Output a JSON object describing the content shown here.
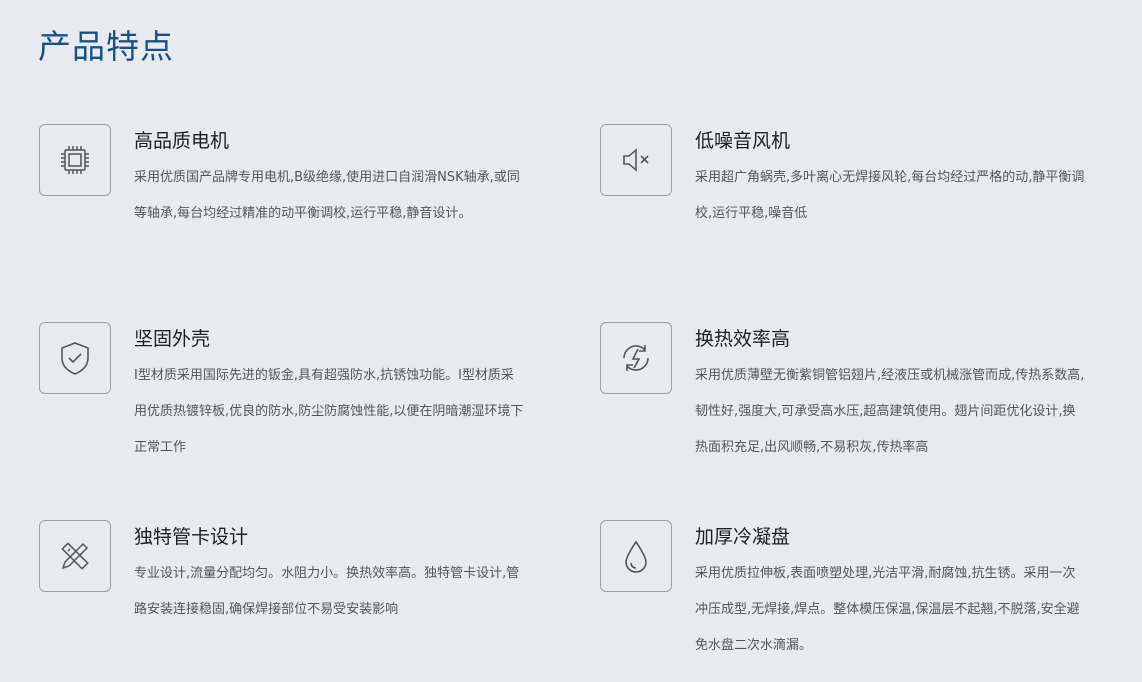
{
  "page": {
    "title": "产品特点"
  },
  "features": [
    {
      "title": "高品质电机",
      "icon": "chip-icon",
      "desc": "采用优质国产品牌专用电机,B级绝缘,使用进口自润滑NSK轴承,或同等轴承,每台均经过精准的动平衡调校,运行平稳,静音设计。"
    },
    {
      "title": "低噪音风机",
      "icon": "speaker-mute-icon",
      "desc": "采用超广角蜗壳,多叶离心无焊接风轮,每台均经过严格的动,静平衡调校,运行平稳,噪音低"
    },
    {
      "title": "坚固外壳",
      "icon": "shield-check-icon",
      "desc": "I型材质采用国际先进的钣金,具有超强防水,抗锈蚀功能。I型材质采用优质热镀锌板,优良的防水,防尘防腐蚀性能,以便在阴暗潮湿环境下正常工作"
    },
    {
      "title": "换热效率高",
      "icon": "energy-cycle-icon",
      "desc": "采用优质薄壁无衡紫铜管铝翅片,经液压或机械涨管而成,传热系数高,韧性好,强度大,可承受高水压,超高建筑使用。翅片间距优化设计,换热面积充足,出风顺畅,不易积灰,传热率高"
    },
    {
      "title": "独特管卡设计",
      "icon": "pencil-ruler-icon",
      "desc": "专业设计,流量分配均匀。水阻力小。换热效率高。独特管卡设计,管路安装连接稳固,确保焊接部位不易受安装影响"
    },
    {
      "title": "加厚冷凝盘",
      "icon": "water-drop-icon",
      "desc": "采用优质拉伸板,表面喷塑处理,光洁平滑,耐腐蚀,抗生锈。采用一次冲压成型,无焊接,焊点。整体模压保温,保温层不起翘,不脱落,安全避免水盘二次水滴漏。"
    }
  ]
}
